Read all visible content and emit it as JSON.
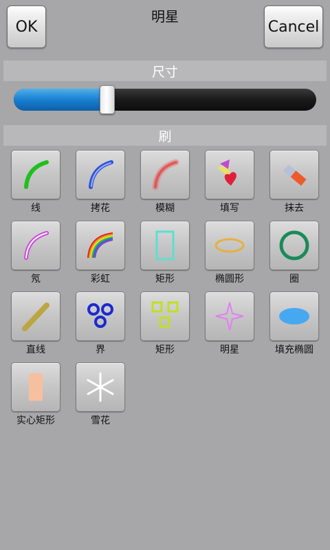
{
  "dialog": {
    "title": "明星",
    "ok_label": "OK",
    "cancel_label": "Cancel"
  },
  "size_section": {
    "header": "尺寸",
    "slider_value_fraction": 0.31
  },
  "brush_section": {
    "header": "刷",
    "brushes": [
      {
        "label": "线",
        "icon": "green-arc-icon"
      },
      {
        "label": "拷花",
        "icon": "blue-arc-icon"
      },
      {
        "label": "模糊",
        "icon": "blurred-red-arc-icon"
      },
      {
        "label": "填写",
        "icon": "fill-heart-icon"
      },
      {
        "label": "抹去",
        "icon": "eraser-icon"
      },
      {
        "label": "氖",
        "icon": "neon-arc-icon"
      },
      {
        "label": "彩虹",
        "icon": "rainbow-icon"
      },
      {
        "label": "矩形",
        "icon": "rectangle-icon"
      },
      {
        "label": "椭圆形",
        "icon": "ellipse-icon"
      },
      {
        "label": "圈",
        "icon": "circle-icon"
      },
      {
        "label": "直线",
        "icon": "straight-line-icon"
      },
      {
        "label": "界",
        "icon": "rings-icon"
      },
      {
        "label": "矩形",
        "icon": "squares-icon"
      },
      {
        "label": "明星",
        "icon": "star-icon"
      },
      {
        "label": "填充椭圆",
        "icon": "filled-ellipse-icon"
      },
      {
        "label": "实心矩形",
        "icon": "filled-rectangle-icon"
      },
      {
        "label": "雪花",
        "icon": "snowflake-icon"
      }
    ]
  },
  "colors": {
    "background": "#a7a6a9",
    "slider_fill": "#1a7fd0",
    "section_bar": "#b8b7ba"
  }
}
